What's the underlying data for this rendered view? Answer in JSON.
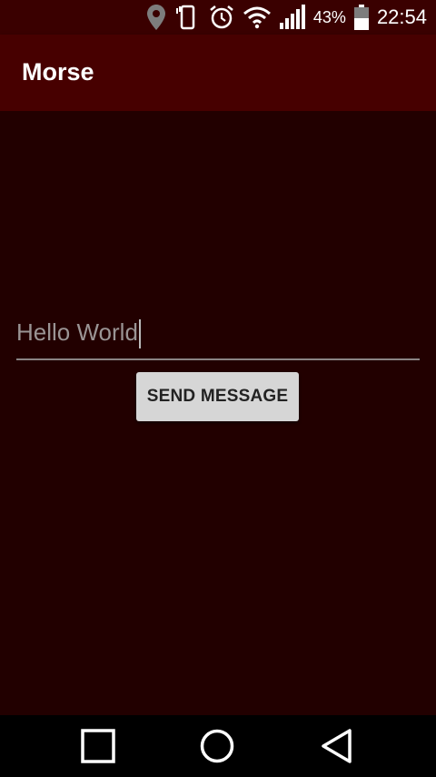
{
  "status_bar": {
    "battery_percent": "43%",
    "time": "22:54",
    "icons": [
      "location-icon",
      "vibrate-icon",
      "alarm-icon",
      "wifi-icon",
      "signal-icon",
      "battery-icon"
    ]
  },
  "app_bar": {
    "title": "Morse"
  },
  "main": {
    "message_input": {
      "value": "Hello World"
    },
    "send_button_label": "SEND MESSAGE"
  },
  "nav_bar": {
    "icons": [
      "recents-icon",
      "home-icon",
      "back-icon"
    ]
  },
  "colors": {
    "background": "#220000",
    "app_bar": "#470000",
    "status_bar": "#3a0000",
    "button": "#d6d6d6"
  }
}
